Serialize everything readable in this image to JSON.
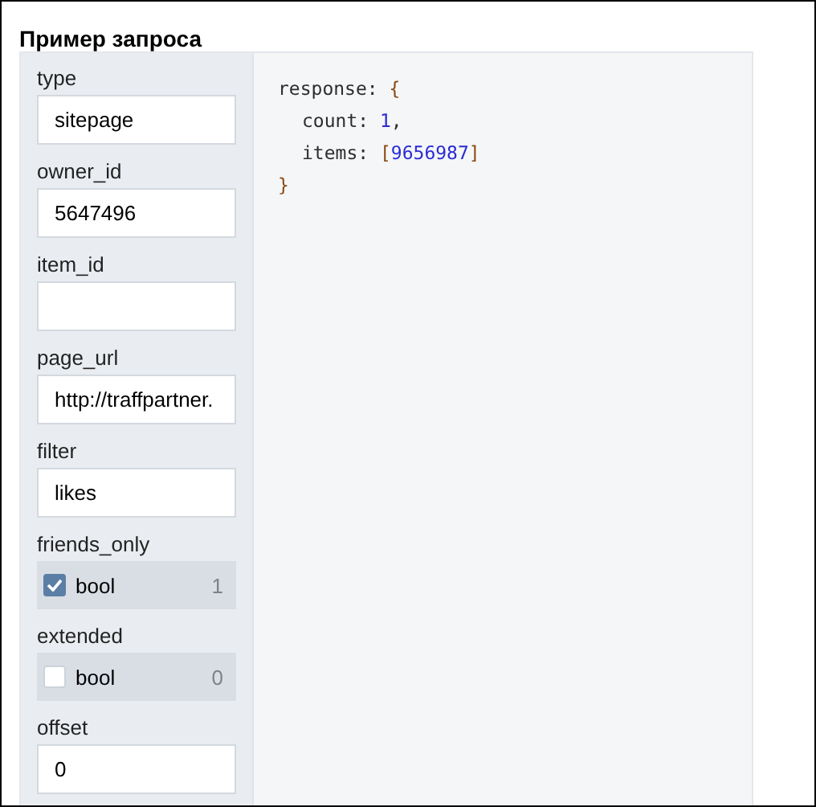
{
  "title": "Пример запроса",
  "params": [
    {
      "kind": "text",
      "name": "type",
      "value": "sitepage"
    },
    {
      "kind": "text",
      "name": "owner_id",
      "value": "5647496"
    },
    {
      "kind": "text",
      "name": "item_id"
    },
    {
      "kind": "text",
      "name": "page_url",
      "value": "http://traffpartner."
    },
    {
      "kind": "text",
      "name": "filter",
      "value": "likes"
    },
    {
      "kind": "bool",
      "name": "friends_only",
      "label": "bool",
      "checked": true,
      "value": "1"
    },
    {
      "kind": "bool",
      "name": "extended",
      "label": "bool",
      "checked": false,
      "value": "0"
    },
    {
      "kind": "text",
      "name": "offset",
      "value": "0"
    }
  ],
  "code": {
    "tokens": [
      {
        "kind": "key",
        "text": "response"
      },
      {
        "kind": "punct",
        "text": ":"
      },
      {
        "kind": "bracket",
        "text": "{"
      }
    ],
    "children": [
      {
        "tokens": [
          {
            "kind": "key",
            "text": "count"
          },
          {
            "kind": "punct",
            "text": ":"
          },
          {
            "kind": "number",
            "text": "1"
          },
          {
            "kind": "punct",
            "text": ","
          }
        ]
      },
      {
        "tokens": [
          {
            "kind": "key",
            "text": "items"
          },
          {
            "kind": "punct",
            "text": ":"
          },
          {
            "kind": "bracket",
            "text": "["
          },
          {
            "kind": "number",
            "text": "9656987"
          },
          {
            "kind": "bracket",
            "text": "]"
          }
        ]
      }
    ],
    "close": [
      {
        "kind": "bracket",
        "text": "}"
      }
    ]
  }
}
